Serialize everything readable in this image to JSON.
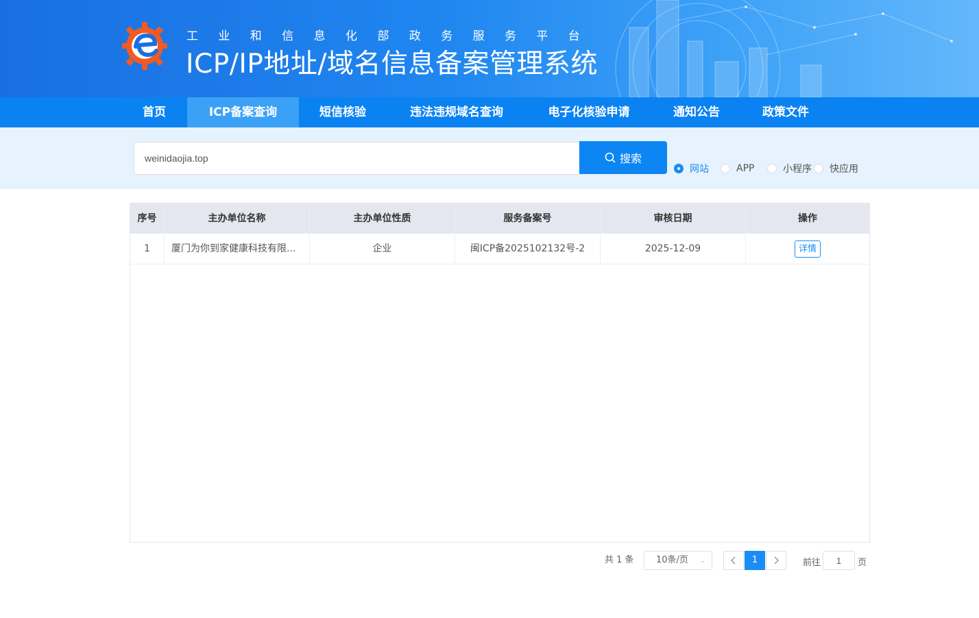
{
  "header": {
    "subtitle": "工业和信息化部政务服务平台",
    "title": "ICP/IP地址/域名信息备案管理系统"
  },
  "nav": {
    "items": [
      {
        "label": "首页",
        "active": false
      },
      {
        "label": "ICP备案查询",
        "active": true
      },
      {
        "label": "短信核验",
        "active": false
      },
      {
        "label": "违法违规域名查询",
        "active": false
      },
      {
        "label": "电子化核验申请",
        "active": false
      },
      {
        "label": "通知公告",
        "active": false
      },
      {
        "label": "政策文件",
        "active": false
      }
    ]
  },
  "search": {
    "value": "weinidaojia.top",
    "button_label": "搜索",
    "types": [
      {
        "label": "网站",
        "checked": true
      },
      {
        "label": "APP",
        "checked": false
      },
      {
        "label": "小程序",
        "checked": false
      },
      {
        "label": "快应用",
        "checked": false
      }
    ]
  },
  "table": {
    "columns": [
      "序号",
      "主办单位名称",
      "主办单位性质",
      "服务备案号",
      "审核日期",
      "操作"
    ],
    "rows": [
      {
        "index": "1",
        "unit_name": "厦门为你到家健康科技有限...",
        "unit_type": "企业",
        "record_no": "闽ICP备2025102132号-2",
        "date": "2025-12-09",
        "action": "详情"
      }
    ]
  },
  "pagination": {
    "total": "共 1 条",
    "page_size": "10条/页",
    "current_page": "1",
    "goto_prefix": "前往",
    "goto_value": "1",
    "goto_suffix": "页"
  },
  "colors": {
    "primary": "#1a8cf5",
    "nav_bg": "#0a82f2",
    "nav_active": "#3ba1f6",
    "search_band": "#e6f2fd",
    "table_header": "#e4e7ef"
  }
}
